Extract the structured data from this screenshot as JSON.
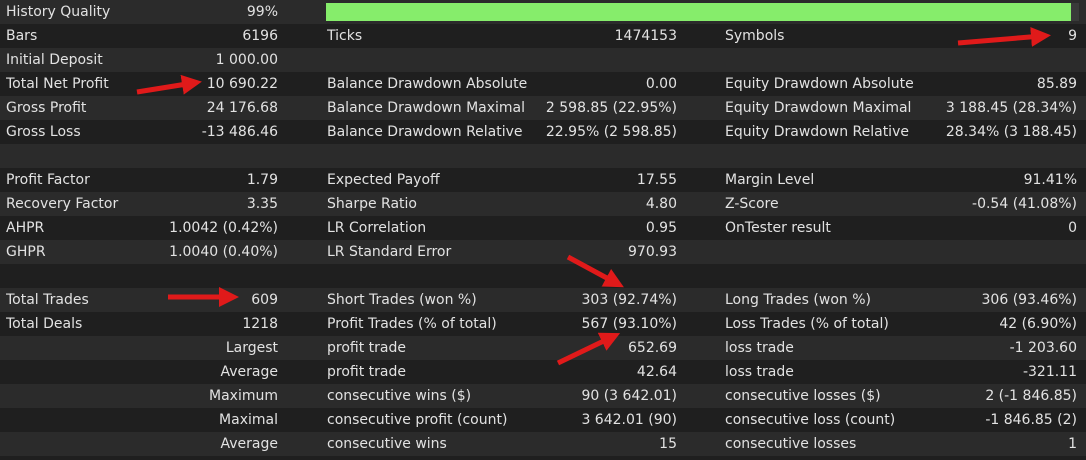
{
  "summary": {
    "history_quality_label": "History Quality",
    "history_quality_value": "99%",
    "history_quality_fraction": 0.99,
    "bars_label": "Bars",
    "bars_value": "6196",
    "ticks_label": "Ticks",
    "ticks_value": "1474153",
    "symbols_label": "Symbols",
    "symbols_value": "9",
    "initial_deposit_label": "Initial Deposit",
    "initial_deposit_value": "1 000.00"
  },
  "profit": {
    "total_net_profit_label": "Total Net Profit",
    "total_net_profit_value": "10 690.22",
    "balance_dd_abs_label": "Balance Drawdown Absolute",
    "balance_dd_abs_value": "0.00",
    "equity_dd_abs_label": "Equity Drawdown Absolute",
    "equity_dd_abs_value": "85.89",
    "gross_profit_label": "Gross Profit",
    "gross_profit_value": "24 176.68",
    "balance_dd_max_label": "Balance Drawdown Maximal",
    "balance_dd_max_value": "2 598.85 (22.95%)",
    "equity_dd_max_label": "Equity Drawdown Maximal",
    "equity_dd_max_value": "3 188.45 (28.34%)",
    "gross_loss_label": "Gross Loss",
    "gross_loss_value": "-13 486.46",
    "balance_dd_rel_label": "Balance Drawdown Relative",
    "balance_dd_rel_value": "22.95% (2 598.85)",
    "equity_dd_rel_label": "Equity Drawdown Relative",
    "equity_dd_rel_value": "28.34% (3 188.45)"
  },
  "factors": {
    "profit_factor_label": "Profit Factor",
    "profit_factor_value": "1.79",
    "expected_payoff_label": "Expected Payoff",
    "expected_payoff_value": "17.55",
    "margin_level_label": "Margin Level",
    "margin_level_value": "91.41%",
    "recovery_factor_label": "Recovery Factor",
    "recovery_factor_value": "3.35",
    "sharpe_ratio_label": "Sharpe Ratio",
    "sharpe_ratio_value": "4.80",
    "z_score_label": "Z-Score",
    "z_score_value": "-0.54 (41.08%)",
    "ahpr_label": "AHPR",
    "ahpr_value": "1.0042 (0.42%)",
    "lr_correlation_label": "LR Correlation",
    "lr_correlation_value": "0.95",
    "ontester_label": "OnTester result",
    "ontester_value": "0",
    "ghpr_label": "GHPR",
    "ghpr_value": "1.0040 (0.40%)",
    "lr_std_error_label": "LR Standard Error",
    "lr_std_error_value": "970.93"
  },
  "trades": {
    "total_trades_label": "Total Trades",
    "total_trades_value": "609",
    "short_trades_label": "Short Trades (won %)",
    "short_trades_value": "303 (92.74%)",
    "long_trades_label": "Long Trades (won %)",
    "long_trades_value": "306 (93.46%)",
    "total_deals_label": "Total Deals",
    "total_deals_value": "1218",
    "profit_trades_label": "Profit Trades (% of total)",
    "profit_trades_value": "567 (93.10%)",
    "loss_trades_label": "Loss Trades (% of total)",
    "loss_trades_value": "42 (6.90%)",
    "largest_label": "Largest",
    "largest_profit_label": "profit trade",
    "largest_profit_value": "652.69",
    "largest_loss_label": "loss trade",
    "largest_loss_value": "-1 203.60",
    "average_label": "Average",
    "average_profit_label": "profit trade",
    "average_profit_value": "42.64",
    "average_loss_label": "loss trade",
    "average_loss_value": "-321.11",
    "maximum_label": "Maximum",
    "max_cons_wins_label": "consecutive wins ($)",
    "max_cons_wins_value": "90 (3 642.01)",
    "max_cons_losses_label": "consecutive losses ($)",
    "max_cons_losses_value": "2 (-1 846.85)",
    "maximal_label": "Maximal",
    "maximal_cons_profit_label": "consecutive profit (count)",
    "maximal_cons_profit_value": "3 642.01 (90)",
    "maximal_cons_loss_label": "consecutive loss (count)",
    "maximal_cons_loss_value": "-1 846.85 (2)",
    "average2_label": "Average",
    "avg_cons_wins_label": "consecutive wins",
    "avg_cons_wins_value": "15",
    "avg_cons_losses_label": "consecutive losses",
    "avg_cons_losses_value": "1"
  },
  "colors": {
    "background": "#1f1f1f",
    "row_alt": "#2b2b2b",
    "text": "#e2e2e2",
    "quality_bar": "#86ed6b",
    "annotation_arrow": "#e01a1a"
  }
}
